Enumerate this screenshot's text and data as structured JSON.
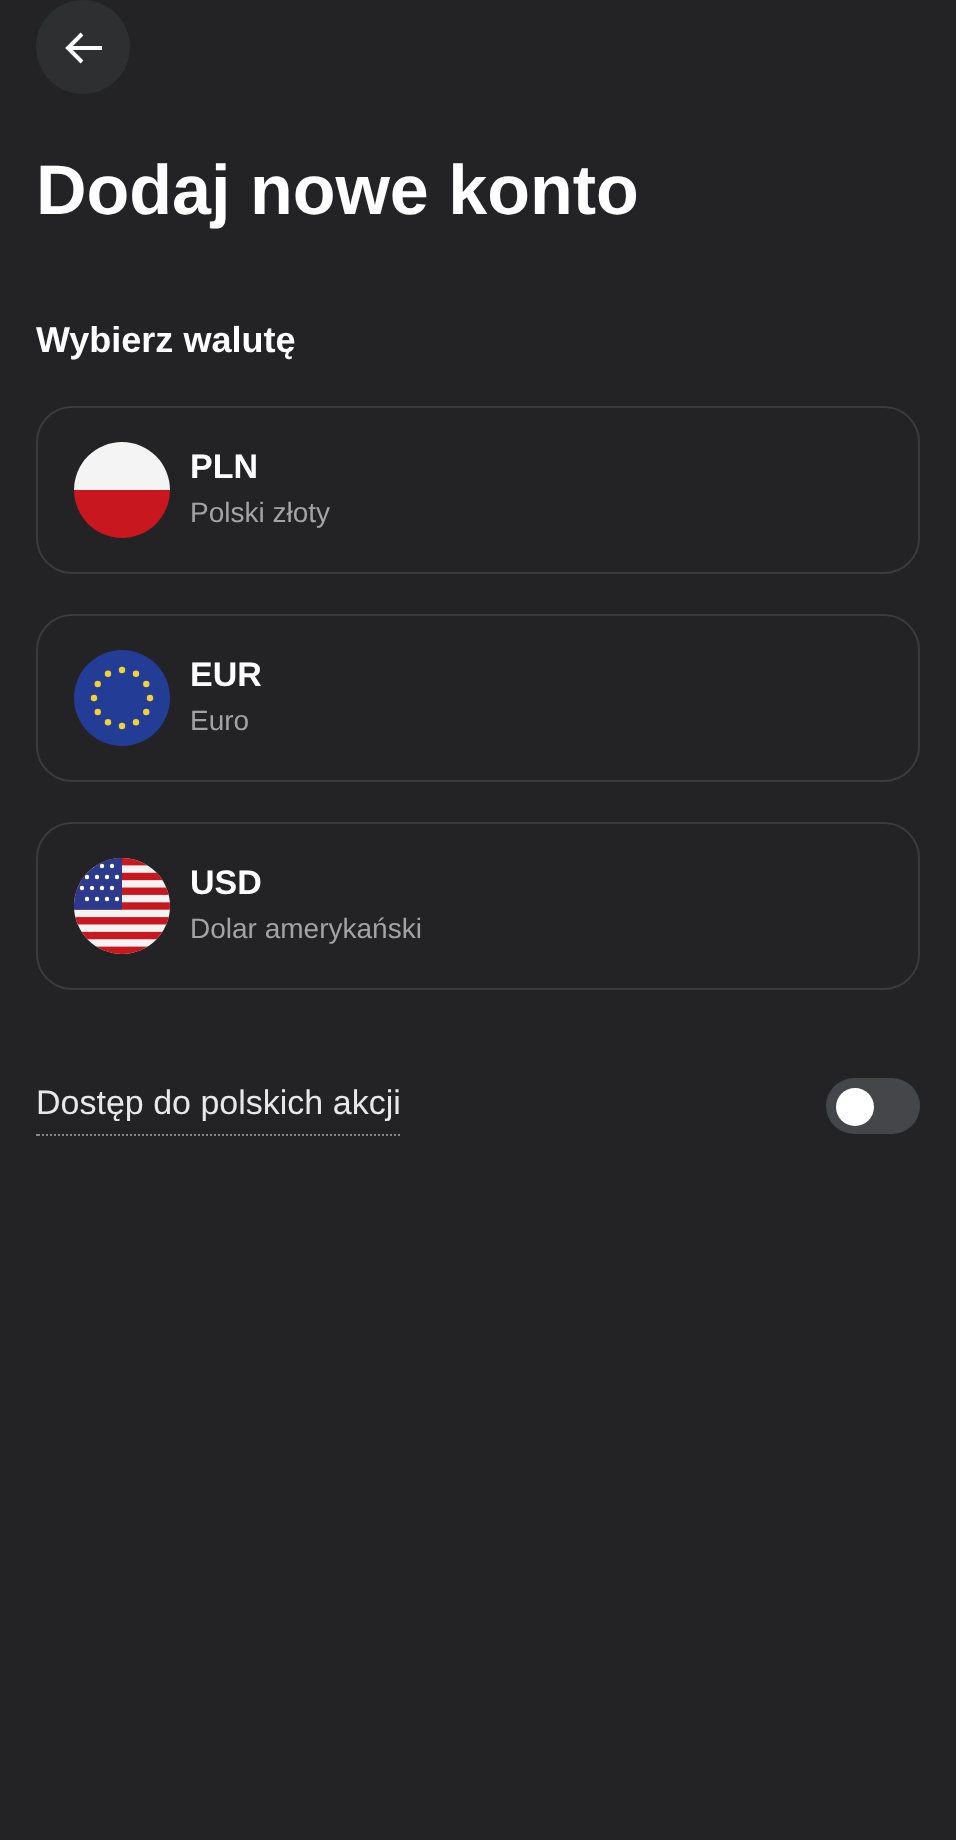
{
  "title": "Dodaj nowe konto",
  "section_heading": "Wybierz walutę",
  "currencies": [
    {
      "kind": "pl",
      "code": "PLN",
      "name": "Polski złoty"
    },
    {
      "kind": "eu",
      "code": "EUR",
      "name": "Euro"
    },
    {
      "kind": "us",
      "code": "USD",
      "name": "Dolar amerykański"
    }
  ],
  "setting": {
    "label": "Dostęp do polskich akcji",
    "on": false
  }
}
